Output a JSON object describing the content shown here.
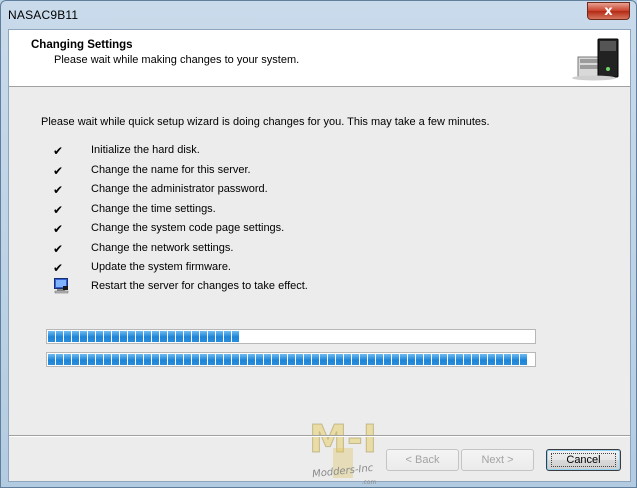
{
  "window": {
    "title": "NASAC9B11",
    "close_glyph": "x"
  },
  "header": {
    "title": "Changing Settings",
    "subtitle": "Please wait while making changes to your system.",
    "graphic_icon": "server-disk-icon"
  },
  "intro": "Please wait while quick setup wizard is doing changes for you.  This may take a few minutes.",
  "steps": [
    {
      "label": "Initialize the hard disk.",
      "status": "done"
    },
    {
      "label": "Change the name for this server.",
      "status": "done"
    },
    {
      "label": "Change the administrator password.",
      "status": "done"
    },
    {
      "label": "Change the time settings.",
      "status": "done"
    },
    {
      "label": "Change the system code page settings.",
      "status": "done"
    },
    {
      "label": "Change the network settings.",
      "status": "done"
    },
    {
      "label": "Update the system firmware.",
      "status": "done"
    },
    {
      "label": "Restart the server for changes to take effect.",
      "status": "in-progress"
    }
  ],
  "check_glyph": "✔",
  "progress": {
    "current_step_fraction": 0.4,
    "overall_fraction": 1.0
  },
  "watermark": {
    "logo_text": "M-I",
    "tagline": "Modders-Inc",
    "suffix": ".com"
  },
  "buttons": {
    "back_label": "< Back",
    "next_label": "Next >",
    "cancel_label": "Cancel"
  },
  "colors": {
    "progress_blue": "#1d84d6",
    "title_close_red": "#c8402a"
  }
}
